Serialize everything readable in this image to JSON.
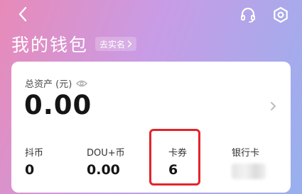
{
  "header": {
    "back_icon": "chevron-left-icon",
    "support_icon": "headset-icon",
    "settings_icon": "gear-icon",
    "title": "我的钱包",
    "verify_label": "去实名",
    "verify_icon": "chevron-right-icon"
  },
  "card": {
    "total_label": "总资产 (元)",
    "visibility_icon": "eye-icon",
    "total_value": "0.00",
    "detail_icon": "chevron-right-icon"
  },
  "assets": [
    {
      "label": "抖币",
      "value": "0"
    },
    {
      "label": "DOU+币",
      "value": "0.00"
    },
    {
      "label": "卡券",
      "value": "6"
    },
    {
      "label": "银行卡",
      "value": ""
    }
  ],
  "colors": {
    "highlight": "#e3242b",
    "gradient_start": "#e88ab8",
    "gradient_end": "#97b1ee"
  }
}
